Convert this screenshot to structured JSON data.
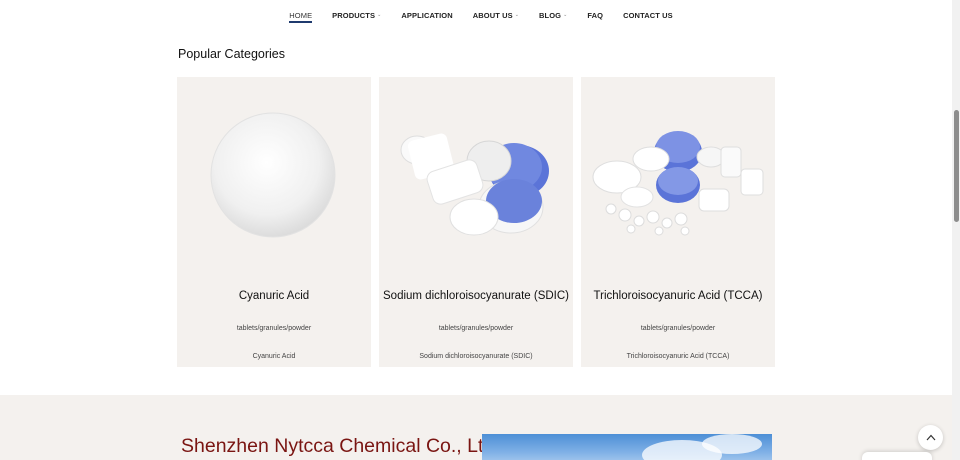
{
  "nav": {
    "items": [
      {
        "label": "HOME",
        "active": true,
        "dropdown": false
      },
      {
        "label": "PRODUCTS",
        "active": false,
        "dropdown": true
      },
      {
        "label": "APPLICATION",
        "active": false,
        "dropdown": false
      },
      {
        "label": "ABOUT US",
        "active": false,
        "dropdown": true
      },
      {
        "label": "BLOG",
        "active": false,
        "dropdown": true
      },
      {
        "label": "FAQ",
        "active": false,
        "dropdown": false
      },
      {
        "label": "CONTACT US",
        "active": false,
        "dropdown": false
      }
    ],
    "active_underline_color": "#1f3a6e"
  },
  "popular": {
    "title": "Popular Categories",
    "cards": [
      {
        "title": "Cyanuric Acid",
        "desc": "tablets/granules/powder",
        "link": "Cyanuric Acid",
        "image": "white-powder-pile"
      },
      {
        "title": "Sodium dichloroisocyanurate (SDIC)",
        "desc": "tablets/granules/powder",
        "link": "Sodium dichloroisocyanurate (SDIC)",
        "image": "white-and-blue-tablets"
      },
      {
        "title": "Trichloroisocyanuric Acid (TCCA)",
        "desc": "tablets/granules/powder",
        "link": "Trichloroisocyanuric Acid (TCCA)",
        "image": "assorted-tablets"
      }
    ]
  },
  "company": {
    "name": "Shenzhen Nytcca Chemical Co., Ltd",
    "name_color": "#7a1512"
  },
  "colors": {
    "card_bg": "#f4f1ee",
    "tablet_blue": "#5b74d8"
  }
}
